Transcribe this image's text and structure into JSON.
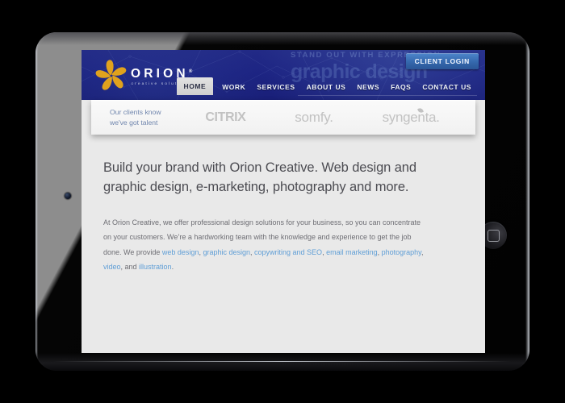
{
  "device": {
    "name": "tablet-device",
    "home_button_icon": "rounded-square-icon",
    "camera_icon": "camera-dot-icon"
  },
  "site": {
    "header": {
      "logo": {
        "mark_icon": "orion-pinwheel-icon",
        "name": "ORION",
        "registered": "®",
        "tagline": "creative solutions"
      },
      "client_login_label": "CLIENT LOGIN",
      "ghost_text_line1": "STAND OUT WITH EXPRESSION",
      "ghost_text_line2": "graphic design",
      "nav_items": [
        {
          "label": "HOME",
          "active": true
        },
        {
          "label": "WORK",
          "active": false
        },
        {
          "label": "SERVICES",
          "active": false
        },
        {
          "label": "ABOUT US",
          "active": false
        },
        {
          "label": "NEWS",
          "active": false
        },
        {
          "label": "FAQS",
          "active": false
        },
        {
          "label": "CONTACT US",
          "active": false
        }
      ]
    },
    "client_strip": {
      "tagline_line1": "Our clients know",
      "tagline_line2": "we've got talent",
      "logos": [
        {
          "name": "citrix-logo",
          "text": "CITRIX"
        },
        {
          "name": "somfy-logo",
          "text": "somfy."
        },
        {
          "name": "syngenta-logo",
          "text": "syngenta."
        }
      ]
    },
    "main": {
      "headline": "Build your brand with Orion Creative. Web design and graphic design, e-marketing, photography and more.",
      "paragraph_parts": [
        {
          "text": "At Orion Creative, we offer professional design solutions for your business, so you can concentrate on your customers. We’re a hardworking team with the knowledge and experience to get the job done. We provide ",
          "link": false
        },
        {
          "text": "web design",
          "link": true
        },
        {
          "text": ", ",
          "link": false
        },
        {
          "text": "graphic design",
          "link": true
        },
        {
          "text": ", ",
          "link": false
        },
        {
          "text": "copywriting and SEO",
          "link": true
        },
        {
          "text": ", ",
          "link": false
        },
        {
          "text": "email marketing",
          "link": true
        },
        {
          "text": ", ",
          "link": false
        },
        {
          "text": "photography",
          "link": true
        },
        {
          "text": ", ",
          "link": false
        },
        {
          "text": "video",
          "link": true
        },
        {
          "text": ", and ",
          "link": false
        },
        {
          "text": "illustration",
          "link": true
        },
        {
          "text": ".",
          "link": false
        }
      ]
    }
  },
  "colors": {
    "header_navy": "#1c2382",
    "logo_gold": "#e0a21d",
    "client_login_blue": "#3568ad",
    "link_blue": "#5f9ed6",
    "tagline_blue": "#6f85ad",
    "content_bg": "#e9e9e9",
    "headline_gray": "#4c4c52",
    "body_gray": "#6e6e74",
    "logo_gray": "#c2c2c2",
    "bezel_gray": "#8d8d8d",
    "bezel_black": "#050505"
  }
}
